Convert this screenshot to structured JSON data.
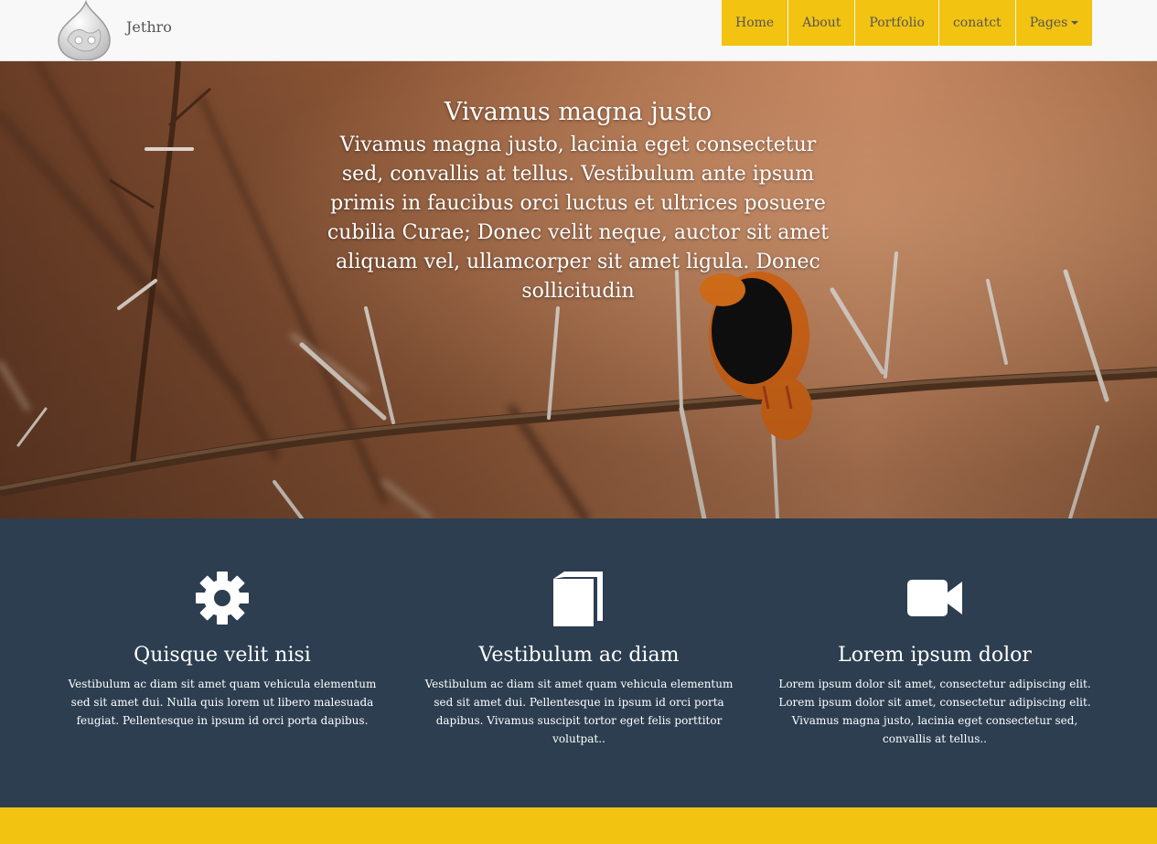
{
  "brand": {
    "name": "Jethro",
    "logo_icon": "drupal-drop-icon"
  },
  "nav": {
    "items": [
      {
        "label": "Home"
      },
      {
        "label": "About"
      },
      {
        "label": "Portfolio"
      },
      {
        "label": "conatct"
      },
      {
        "label": "Pages",
        "dropdown": true
      }
    ]
  },
  "hero": {
    "title": "Vivamus magna justo",
    "body": "Vivamus magna justo, lacinia eget consectetur sed, convallis at tellus. Vestibulum ante ipsum primis in faucibus orci luctus et ultrices posuere cubilia Curae; Donec velit neque, auctor sit amet aliquam vel, ullamcorper sit amet ligula. Donec sollicitudin"
  },
  "features": [
    {
      "icon": "gear-icon",
      "title": "Quisque velit nisi",
      "text": "Vestibulum ac diam sit amet quam vehicula elementum sed sit amet dui. Nulla quis lorem ut libero malesuada feugiat. Pellentesque in ipsum id orci porta dapibus."
    },
    {
      "icon": "book-icon",
      "title": "Vestibulum ac diam",
      "text": "Vestibulum ac diam sit amet quam vehicula elementum sed sit amet dui. Pellentesque in ipsum id orci porta dapibus. Vivamus suscipit tortor eget felis porttitor volutpat.."
    },
    {
      "icon": "video-camera-icon",
      "title": "Lorem ipsum dolor",
      "text": "Lorem ipsum dolor sit amet, consectetur adipiscing elit. Lorem ipsum dolor sit amet, consectetur adipiscing elit. Vivamus magna justo, lacinia eget consectetur sed, convallis at tellus.."
    }
  ],
  "colors": {
    "accent": "#f2c311",
    "dark_band": "#2c3e50",
    "navbar_bg": "#f8f8f8"
  }
}
